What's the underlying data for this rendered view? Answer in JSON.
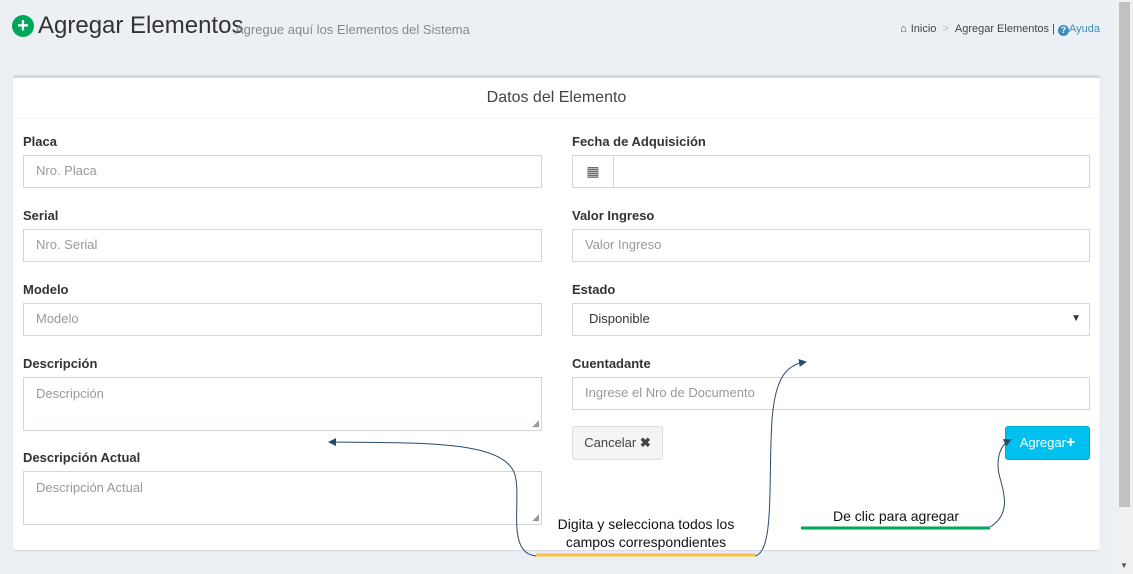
{
  "header": {
    "title": "Agregar Elementos",
    "subtitle": "Agregue aquí los Elementos del Sistema",
    "breadcrumb": {
      "home": "Inicio",
      "sep": ">",
      "current": "Agregar Elementos |",
      "help": "Ayuda"
    }
  },
  "form": {
    "title": "Datos del Elemento",
    "placa": {
      "label": "Placa",
      "placeholder": "Nro. Placa"
    },
    "serial": {
      "label": "Serial",
      "placeholder": "Nro. Serial"
    },
    "modelo": {
      "label": "Modelo",
      "placeholder": "Modelo"
    },
    "descripcion": {
      "label": "Descripción",
      "placeholder": "Descripción"
    },
    "descripcion_actual": {
      "label": "Descripción Actual",
      "placeholder": "Descripción Actual"
    },
    "fecha": {
      "label": "Fecha de Adquisición",
      "value": ""
    },
    "valor": {
      "label": "Valor Ingreso",
      "placeholder": "Valor Ingreso"
    },
    "estado": {
      "label": "Estado",
      "value": "Disponible"
    },
    "cuentadante": {
      "label": "Cuentadante",
      "placeholder": "Ingrese el Nro de Documento"
    },
    "cancel_label": "Cancelar",
    "add_label": "Agregar"
  },
  "annotations": {
    "fields_note": "Digita y selecciona todos los campos correspondientes",
    "add_note": "De clic para agregar"
  },
  "colors": {
    "accent": "#00c0ef",
    "success": "#00a65a",
    "link": "#3c8dbc",
    "highlight_orange": "#f7c244",
    "highlight_green": "#00a65a"
  }
}
